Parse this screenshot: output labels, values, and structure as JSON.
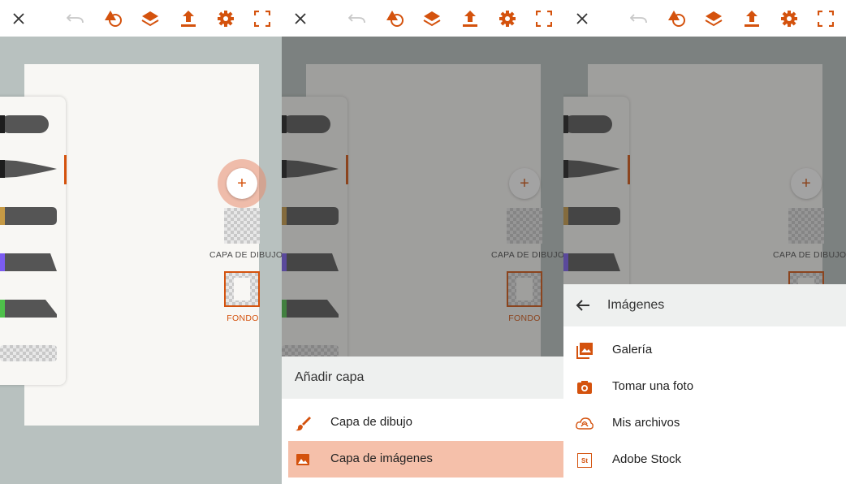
{
  "toolbar_icons": [
    "close-icon",
    "undo-icon",
    "shapes-icon",
    "layers-icon",
    "share-icon",
    "settings-icon",
    "fullscreen-icon"
  ],
  "accent_color": "#d4520d",
  "brush_tip_colors": [
    "#1d1d1d",
    "#1d1d1d",
    "#c69a45",
    "#7b5cf0",
    "#4ec04a"
  ],
  "layers": {
    "add_symbol": "+",
    "drawing_label": "CAPA DE DIBUJO",
    "background_label": "FONDO"
  },
  "add_layer_sheet": {
    "title": "Añadir capa",
    "items": [
      {
        "label": "Capa de dibujo",
        "icon": "brush-icon"
      },
      {
        "label": "Capa de imágenes",
        "icon": "image-icon"
      }
    ]
  },
  "images_sheet": {
    "back_icon": "back-arrow-icon",
    "title": "Imágenes",
    "items": [
      {
        "label": "Galería",
        "icon": "gallery-icon"
      },
      {
        "label": "Tomar una foto",
        "icon": "camera-icon"
      },
      {
        "label": "Mis archivos",
        "icon": "creative-cloud-icon"
      },
      {
        "label": "Adobe Stock",
        "icon": "adobe-stock-icon",
        "badge": "St"
      }
    ]
  }
}
